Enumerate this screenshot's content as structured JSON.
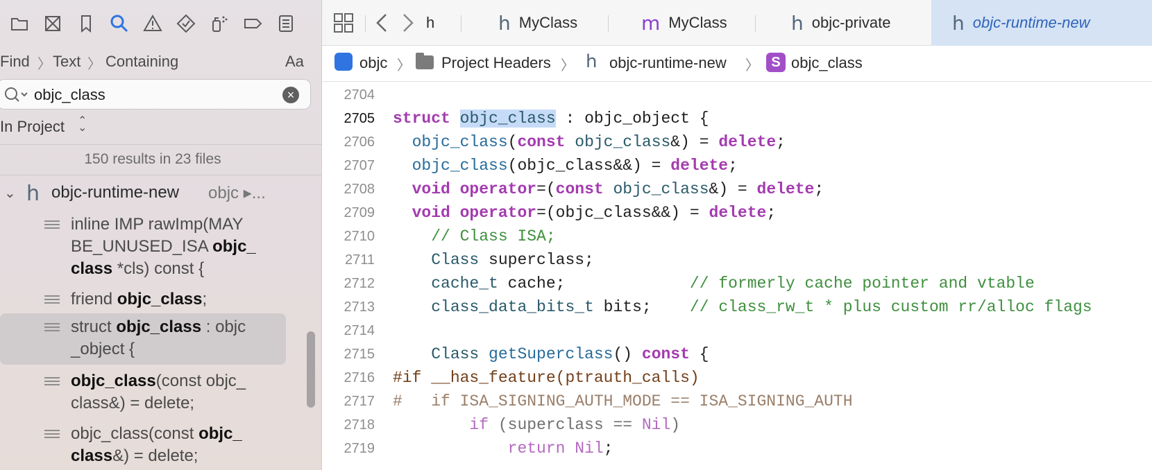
{
  "navigator": {
    "tools": [
      "folder-icon",
      "source-control-icon",
      "bookmark-icon",
      "find-icon",
      "issue-icon",
      "test-icon",
      "debug-icon",
      "breakpoint-icon",
      "report-icon"
    ],
    "find_path": {
      "mode": "Find",
      "kind": "Text",
      "match": "Containing",
      "case": "Aa"
    },
    "search": {
      "value": "objc_class"
    },
    "scope": "In Project",
    "results_count": "150 results in 23 files",
    "file_group": {
      "name": "objc-runtime-new",
      "path": "objc ▸..."
    },
    "results": [
      {
        "pre": "inline IMP rawImp(MAY BE_UNUSED_ISA ",
        "match": "objc_ class",
        "post": " *cls) const {"
      },
      {
        "pre": "friend ",
        "match": "objc_class",
        "post": ";"
      },
      {
        "pre": "struct ",
        "match": "objc_class",
        "post": " : objc _object {"
      },
      {
        "pre": "",
        "match": "objc_class",
        "post": "(const objc_ class&) = delete;"
      },
      {
        "pre": "objc_class(const ",
        "match": "objc_ class",
        "post": "&) = delete;"
      }
    ]
  },
  "editor": {
    "tabs": [
      {
        "icon": "h",
        "label": "h"
      },
      {
        "icon": "h",
        "label": "MyClass"
      },
      {
        "icon": "m",
        "label": "MyClass"
      },
      {
        "icon": "h",
        "label": "objc-private"
      },
      {
        "icon": "h",
        "label": "objc-runtime-new"
      }
    ],
    "jump_bar": [
      "objc",
      "Project Headers",
      "objc-runtime-new",
      "objc_class"
    ],
    "lines": [
      {
        "n": "2704"
      },
      {
        "n": "2705"
      },
      {
        "n": "2706"
      },
      {
        "n": "2707"
      },
      {
        "n": "2708"
      },
      {
        "n": "2709"
      },
      {
        "n": "2710"
      },
      {
        "n": "2711"
      },
      {
        "n": "2712"
      },
      {
        "n": "2713"
      },
      {
        "n": "2714"
      },
      {
        "n": "2715"
      },
      {
        "n": "2716"
      },
      {
        "n": "2717"
      },
      {
        "n": "2718"
      },
      {
        "n": "2719"
      }
    ],
    "code": {
      "l2705": {
        "kw": "struct",
        "name": "objc_class",
        "rest": " : objc_object {"
      },
      "l2706": {
        "fn": "objc_class",
        "open": "(",
        "kw1": "const",
        "ty": " objc_class",
        "mid": "&) = ",
        "kw2": "delete",
        "end": ";"
      },
      "l2707": {
        "fn": "objc_class",
        "mid": "(objc_class&&) = ",
        "kw": "delete",
        "end": ";"
      },
      "l2708": {
        "kw1": "void",
        "op": " operator",
        "eq": "=(",
        "kw2": "const",
        "ty": " objc_class",
        "mid": "&) = ",
        "kw3": "delete",
        "end": ";"
      },
      "l2709": {
        "kw1": "void",
        "op": " operator",
        "mid": "=(objc_class&&) = ",
        "kw2": "delete",
        "end": ";"
      },
      "l2710": {
        "cm": "// Class ISA;"
      },
      "l2711": {
        "ty": "Class",
        "rest": " superclass;"
      },
      "l2712": {
        "ty": "cache_t",
        "rest": " cache;",
        "cm": "// formerly cache pointer and vtable"
      },
      "l2713": {
        "ty": "class_data_bits_t",
        "rest": " bits;",
        "cm": "// class_rw_t * plus custom rr/alloc flags"
      },
      "l2715": {
        "ty": "Class",
        "fn": " getSuperclass",
        "mid": "() ",
        "kw": "const",
        "end": " {"
      },
      "l2716": {
        "pp": "#if __has_feature(ptrauth_calls)"
      },
      "l2717": {
        "pg": "#   if ISA_SIGNING_AUTH_MODE == ISA_SIGNING_AUTH"
      },
      "l2718": {
        "kw": "if",
        "mid": " (superclass == ",
        "pg": "Nil",
        "end": ")"
      },
      "l2719": {
        "kw": "return",
        "pg": " Nil",
        "end": ";"
      }
    }
  }
}
